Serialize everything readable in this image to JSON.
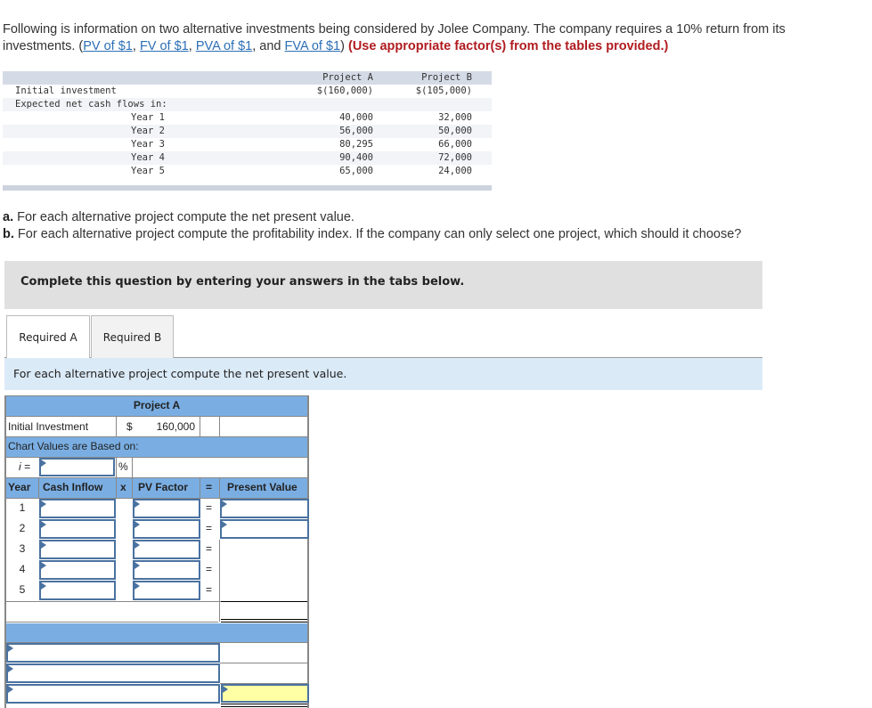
{
  "intro": {
    "text_before": "Following is information on two alternative investments being considered by Jolee Company. The company requires a 10% return from its investments. (",
    "links": [
      "PV of $1",
      "FV of $1",
      "PVA of $1",
      "FVA of $1"
    ],
    "sep1": ", ",
    "sep2": ", ",
    "sep3": ", and ",
    "close": ") ",
    "warning": "(Use appropriate factor(s) from the tables provided.)"
  },
  "given_table": {
    "columns": [
      "Project A",
      "Project B"
    ],
    "initial_label": "Initial investment",
    "initial": [
      "$(160,000)",
      "$(105,000)"
    ],
    "flows_label": "Expected net cash flows in:",
    "years": [
      {
        "label": "Year 1",
        "a": "40,000",
        "b": "32,000"
      },
      {
        "label": "Year 2",
        "a": "56,000",
        "b": "50,000"
      },
      {
        "label": "Year 3",
        "a": "80,295",
        "b": "66,000"
      },
      {
        "label": "Year 4",
        "a": "90,400",
        "b": "72,000"
      },
      {
        "label": "Year 5",
        "a": "65,000",
        "b": "24,000"
      }
    ]
  },
  "questions": {
    "a_label": "a.",
    "a_text": " For each alternative project compute the net present value.",
    "b_label": "b.",
    "b_text": " For each alternative project compute the profitability index. If the company can only select one project, which should it choose?"
  },
  "banner": "Complete this question by entering your answers in the tabs below.",
  "tabs": [
    {
      "label": "Required A",
      "active": true
    },
    {
      "label": "Required B",
      "active": false
    }
  ],
  "instruction": "For each alternative project compute the net present value.",
  "answer_grid": {
    "title": "Project A",
    "initial_label": "Initial Investment",
    "currency": "$",
    "initial_value": "160,000",
    "based_on_label": "Chart Values are Based on:",
    "i_label": "i =",
    "i_value": "",
    "percent": "%",
    "headers": {
      "year": "Year",
      "cash": "Cash Inflow",
      "x": "x",
      "factor": "PV Factor",
      "eq": "=",
      "pv": "Present Value"
    },
    "rows": [
      {
        "year": "1",
        "eq": "="
      },
      {
        "year": "2",
        "eq": "="
      },
      {
        "year": "3",
        "eq": "="
      },
      {
        "year": "4",
        "eq": "="
      },
      {
        "year": "5",
        "eq": "="
      }
    ]
  }
}
